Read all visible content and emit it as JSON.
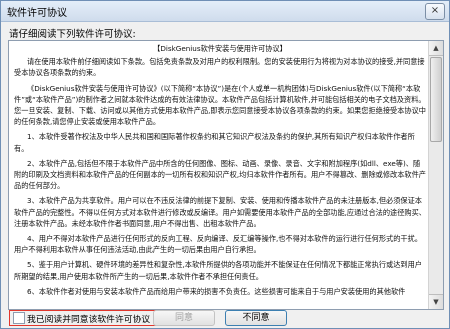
{
  "window": {
    "title": "软件许可协议",
    "close_glyph": "×"
  },
  "prompt": "请仔细阅读下列软件许可协议:",
  "license": {
    "doc_title": "【DiskGenius软件安装与使用许可协议】",
    "paragraphs": [
      "请在使用本软件前仔细阅读如下条款。包括免责条款及对用户的权利限制。您的安装使用行为将视为对本协议的接受,并同意接受本协议各项条款的约束。",
      "《DiskGenius软件安装与使用许可协议》(以下简称“本协议”)是在(个人或单一机构团体)与DiskGenius软件(以下简称“本软件”或“本软件产品”)的制作者之间就本软件达成的有效法律协议。本软件产品包括计算机软件,并可能包括相关的电子文档及资料。您一旦安装、复制、下载、访问或以其他方式使用本软件产品,即表示您同意接受本协议各项条款的约束。如果您拒绝接受本协议中的任何条款,请您停止安装或使用本软件产品。",
      "1、本软件受著作权法及中华人民共和国和国际著作权条约和其它知识产权法及条约的保护,其所有知识产权归本软件作者所有。",
      "2、本软件产品,包括但不限于本软件产品中所含的任何图像、图标、动画、录像、录音、文字和附加程序(如dll、exe等)、随附的印刷及文档资料和本软件产品的任何副本的一切所有权和知识产权,均归本软件作者所有。用户不得篡改、删除或修改本软件产品的任何部分。",
      "3、本软件产品为共享软件。用户可以在不违反法律的前提下复制、安装、使用和传播本软件产品的未注册版本,但必须保证本软件产品的完整性。不得以任何方式对本软件进行修改或反编译。用户如需要使用本软件产品的全部功能,应通过合法的途径购买、注册本软件产品。未经本软件作者书面同意,用户不得出售、出租本软件产品。",
      "4、用户不得对本软件产品进行任何形式的反向工程、反向编译、反汇编等操作,也不得对本软件的运行进行任何形式的干扰。用户不得利用本软件从事任何违法活动,由此产生的一切后果由用户自行承担。",
      "5、鉴于用户计算机、硬件环境的差异性和复杂性,本软件所提供的各项功能并不能保证在任何情况下都能正常执行或达到用户所期望的结果,用户使用本软件所产生的一切后果,本软件作者不承担任何责任。",
      "6、本软件作者对使用与安装本软件产品而给用户带来的损害不负责任。这些损害可能来自于与用户安装使用的其他软件"
    ]
  },
  "agree_checkbox_label": "我已阅读并同意该软件许可协议",
  "buttons": {
    "agree": "同意",
    "disagree": "不同意"
  },
  "scrollbar": {
    "up_glyph": "▲",
    "down_glyph": "▼"
  }
}
